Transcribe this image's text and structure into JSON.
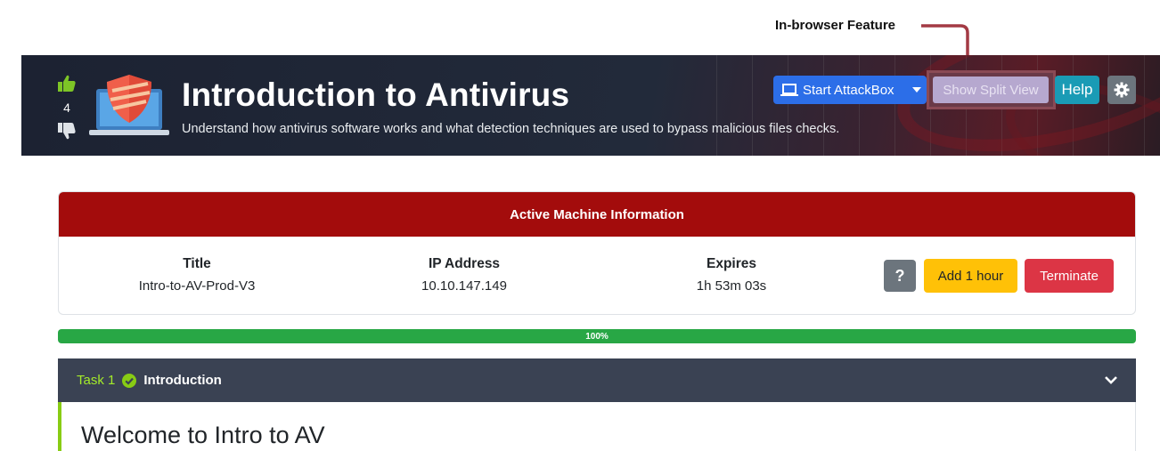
{
  "annotation": {
    "label": "In-browser Feature",
    "arrow_color": "#a33a44"
  },
  "header": {
    "vote_count": "4",
    "title": "Introduction to Antivirus",
    "subtitle": "Understand how antivirus software works and what detection techniques are used to bypass malicious files checks.",
    "start_attackbox": "Start AttackBox",
    "split_view": "Show Split View",
    "help": "Help",
    "icons": {
      "upvote": "thumbs-up-icon",
      "downvote": "thumbs-down-icon",
      "room": "shield-laptop-icon",
      "attackbox": "laptop-icon",
      "settings": "gear-icon"
    }
  },
  "machine": {
    "heading": "Active Machine Information",
    "title_label": "Title",
    "title_value": "Intro-to-AV-Prod-V3",
    "ip_label": "IP Address",
    "ip_value": "10.10.147.149",
    "expires_label": "Expires",
    "expires_value": "1h 53m 03s",
    "help_button": "?",
    "add_hour": "Add 1 hour",
    "terminate": "Terminate"
  },
  "progress": {
    "value": 1.0,
    "label": "100%"
  },
  "task": {
    "number": "Task 1",
    "name": "Introduction",
    "status": "completed",
    "heading": "Welcome to Intro to AV"
  },
  "colors": {
    "accent_blue": "#2c6ee8",
    "machine_red": "#a30c0c",
    "progress_green": "#28a745",
    "task_green": "#a3ea2a",
    "help_teal": "#1a9bb5",
    "add_yellow": "#ffc107",
    "terminate_red": "#dc3545"
  }
}
